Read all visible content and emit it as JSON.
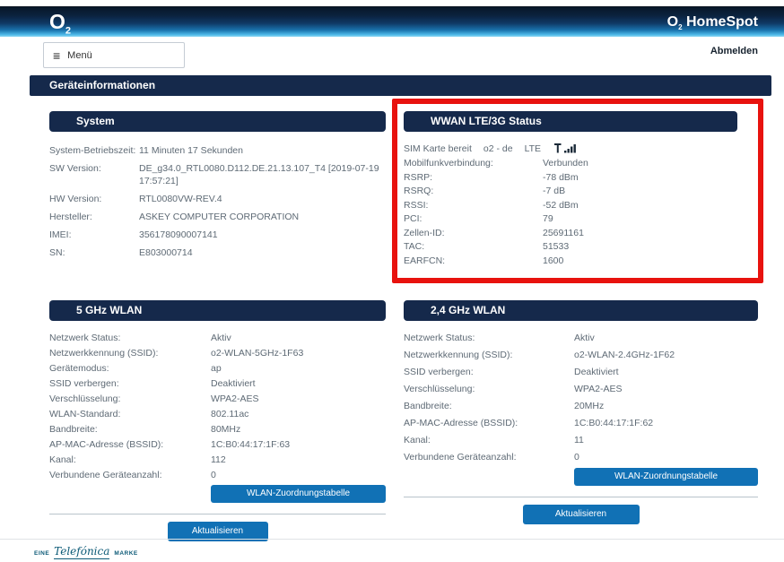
{
  "header": {
    "logo_o": "O",
    "logo_sub": "2",
    "product_o": "O",
    "product_sub": "2",
    "product_name": "HomeSpot",
    "menu_label": "Menü",
    "logout_label": "Abmelden"
  },
  "icons": {
    "menu_glyph": "≡",
    "signal": "signal-strength-bars"
  },
  "page_title": "Geräteinformationen",
  "sections": {
    "system": {
      "title": "System",
      "rows": [
        {
          "label": "System-Betriebszeit:",
          "value": "11 Minuten 17 Sekunden"
        },
        {
          "label": "SW Version:",
          "value": "DE_g34.0_RTL0080.D112.DE.21.13.107_T4 [2019-07-19 17:57:21]"
        },
        {
          "label": "HW Version:",
          "value": "RTL0080VW-REV.4"
        },
        {
          "label": "Hersteller:",
          "value": "ASKEY COMPUTER CORPORATION"
        },
        {
          "label": "IMEI:",
          "value": "356178090007141"
        },
        {
          "label": "SN:",
          "value": "E803000714"
        }
      ]
    },
    "wwan": {
      "title": "WWAN LTE/3G Status",
      "sim_status": "SIM Karte bereit",
      "operator": "o2 - de",
      "network_type": "LTE",
      "rows": [
        {
          "label": "Mobilfunkverbindung:",
          "value": "Verbunden"
        },
        {
          "label": "RSRP:",
          "value": "-78 dBm"
        },
        {
          "label": "RSRQ:",
          "value": "-7 dB"
        },
        {
          "label": "RSSI:",
          "value": "-52 dBm"
        },
        {
          "label": "PCI:",
          "value": "79"
        },
        {
          "label": "Zellen-ID:",
          "value": "25691161"
        },
        {
          "label": "TAC:",
          "value": "51533"
        },
        {
          "label": "EARFCN:",
          "value": "1600"
        }
      ]
    },
    "wlan5": {
      "title": "5 GHz WLAN",
      "rows": [
        {
          "label": "Netzwerk Status:",
          "value": "Aktiv"
        },
        {
          "label": "Netzwerkkennung (SSID):",
          "value": "o2-WLAN-5GHz-1F63"
        },
        {
          "label": "Gerätemodus:",
          "value": "ap"
        },
        {
          "label": "SSID verbergen:",
          "value": "Deaktiviert"
        },
        {
          "label": "Verschlüsselung:",
          "value": "WPA2-AES"
        },
        {
          "label": "WLAN-Standard:",
          "value": "802.11ac"
        },
        {
          "label": "Bandbreite:",
          "value": "80MHz"
        },
        {
          "label": "AP-MAC-Adresse (BSSID):",
          "value": "1C:B0:44:17:1F:63"
        },
        {
          "label": "Kanal:",
          "value": "112"
        },
        {
          "label": "Verbundene Geräteanzahl:",
          "value": "0"
        }
      ],
      "table_button_label": "WLAN-Zuordnungstabelle",
      "refresh_button_label": "Aktualisieren"
    },
    "wlan24": {
      "title": "2,4 GHz WLAN",
      "rows": [
        {
          "label": "Netzwerk Status:",
          "value": "Aktiv"
        },
        {
          "label": "Netzwerkkennung (SSID):",
          "value": "o2-WLAN-2.4GHz-1F62"
        },
        {
          "label": "SSID verbergen:",
          "value": "Deaktiviert"
        },
        {
          "label": "Verschlüsselung:",
          "value": "WPA2-AES"
        },
        {
          "label": "Bandbreite:",
          "value": "20MHz"
        },
        {
          "label": "AP-MAC-Adresse (BSSID):",
          "value": "1C:B0:44:17:1F:62"
        },
        {
          "label": "Kanal:",
          "value": "11"
        },
        {
          "label": "Verbundene Geräteanzahl:",
          "value": "0"
        }
      ],
      "table_button_label": "WLAN-Zuordnungstabelle",
      "refresh_button_label": "Aktualisieren"
    }
  },
  "footer": {
    "brand_prefix": "EINE",
    "brand_name": "Telefónica",
    "brand_suffix": "MARKE"
  },
  "colors": {
    "header_navy": "#15294b",
    "button_blue": "#1171b5",
    "highlight_red": "#e8120e",
    "header_gradient_bottom": "#8fd9f4",
    "text_gray": "#5e6a75"
  }
}
